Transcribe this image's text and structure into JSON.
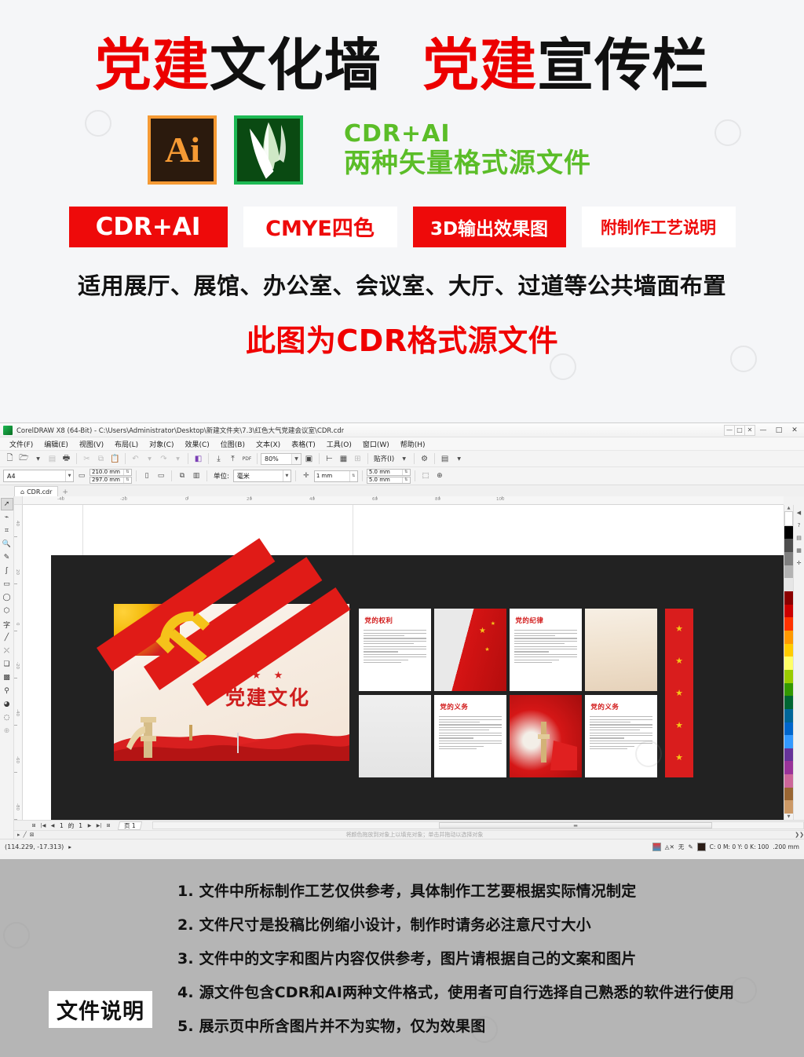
{
  "promo": {
    "title_parts": [
      {
        "text": "党建",
        "color": "red"
      },
      {
        "text": "文化墙",
        "color": "black"
      },
      {
        "text": " ",
        "color": "black"
      },
      {
        "text": "党建",
        "color": "red"
      },
      {
        "text": "宣传栏",
        "color": "black"
      }
    ],
    "title_full": "党建文化墙 党建宣传栏",
    "ai_icon_label": "Ai",
    "green_line1": "CDR+AI",
    "green_line2": "两种矢量格式源文件",
    "badges": [
      {
        "label": "CDR+AI",
        "style": "solid"
      },
      {
        "label": "CMYE四色",
        "style": "hollow"
      },
      {
        "label": "3D输出效果图",
        "style": "solid"
      },
      {
        "label": "附制作工艺说明",
        "style": "hollow"
      }
    ],
    "line_black": "适用展厅、展馆、办公室、会议室、大厅、过道等公共墙面布置",
    "line_red": "此图为CDR格式源文件",
    "colors": {
      "red": "#ee0a0a",
      "green": "#5bbd28",
      "black": "#101010"
    }
  },
  "coreldraw": {
    "title": "CorelDRAW X8 (64-Bit) - C:\\Users\\Administrator\\Desktop\\新建文件夹\\7.3\\红色大气党建会议室\\CDR.cdr",
    "window_buttons": [
      "—",
      "□",
      "✕"
    ],
    "doc_buttons": [
      "—",
      "□",
      "✕"
    ],
    "menus": [
      "文件(F)",
      "编辑(E)",
      "视图(V)",
      "布局(L)",
      "对象(C)",
      "效果(C)",
      "位图(B)",
      "文本(X)",
      "表格(T)",
      "工具(O)",
      "窗口(W)",
      "帮助(H)"
    ],
    "toolbar": {
      "zoom_level": "80%",
      "snap_label": "贴齐(I)",
      "icons": [
        "new-icon",
        "open-icon",
        "save-icon",
        "print-icon",
        "cut-icon",
        "copy-icon",
        "paste-icon",
        "undo-icon",
        "redo-icon",
        "publish-pdf-icon",
        "import-icon",
        "export-icon",
        "export-pdf-icon"
      ]
    },
    "propertybar": {
      "page_size": "A4",
      "width": "210.0 mm",
      "height": "297.0 mm",
      "units_label": "单位:",
      "units_value": "毫米",
      "nudge": "1 mm",
      "duplicate_x": "5.0 mm",
      "duplicate_y": "5.0 mm"
    },
    "document_tab": "CDR.cdr",
    "tab_plus": "+",
    "toolbox": [
      "pick-tool",
      "shape-tool",
      "crop-tool",
      "zoom-tool",
      "freehand-tool",
      "artistic-media-tool",
      "rectangle-tool",
      "ellipse-tool",
      "polygon-tool",
      "text-tool",
      "dimension-tool",
      "connector-tool",
      "drop-shadow-tool",
      "transparency-tool",
      "color-eyedropper-tool",
      "fill-tool",
      "outline-tool",
      "quick-customize"
    ],
    "ruler": {
      "h_labels": [
        "-40",
        "-20",
        "0",
        "20",
        "40",
        "60",
        "80",
        "100"
      ],
      "v_labels": [
        "40",
        "20",
        "0",
        "-20",
        "-40",
        "-60",
        "-80"
      ]
    },
    "page_nav": {
      "first": "|◀",
      "prev": "◀",
      "current": "1",
      "of": "的",
      "total": "1",
      "next": "▶",
      "last": "▶|",
      "add": "⊞",
      "page_tab": "页 1"
    },
    "object_hint": "将颜色拖放到对象上以填充对象；单击并拖动以选择对象",
    "status": {
      "coords": "(114.229, -17.313)",
      "fill_label": "无",
      "outline_color": "C: 0 M: 0 Y: 0 K: 100",
      "outline_width": ".200 mm"
    },
    "artwork": {
      "main_banner_title": "党建文化",
      "stars": "★ ★ ★",
      "panels": [
        {
          "kind": "text",
          "title": "党的权利",
          "lines": 13
        },
        {
          "kind": "image",
          "title": "",
          "image": "china-flag"
        },
        {
          "kind": "text",
          "title": "党的纪律",
          "lines": 13
        },
        {
          "kind": "image",
          "title": "",
          "image": "paper-texture"
        },
        {
          "kind": "image",
          "title": "",
          "image": "blank-gray"
        },
        {
          "kind": "text",
          "title": "党的义务",
          "lines": 13
        },
        {
          "kind": "image",
          "title": "",
          "image": "red-flag-column"
        },
        {
          "kind": "text",
          "title": "党的义务",
          "lines": 13
        }
      ],
      "star_bar_count": 5,
      "star_glyph": "★"
    }
  },
  "footer": {
    "label": "文件说明",
    "notes": [
      "1. 文件中所标制作工艺仅供参考，具体制作工艺要根据实际情况制定",
      "2. 文件尺寸是投稿比例缩小设计，制作时请务必注意尺寸大小",
      "3. 文件中的文字和图片内容仅供参考，图片请根据自己的文案和图片",
      "4. 源文件包含CDR和AI两种文件格式，使用者可自行选择自己熟悉的软件进行使用",
      "5. 展示页中所含图片并不为实物，仅为效果图"
    ]
  }
}
